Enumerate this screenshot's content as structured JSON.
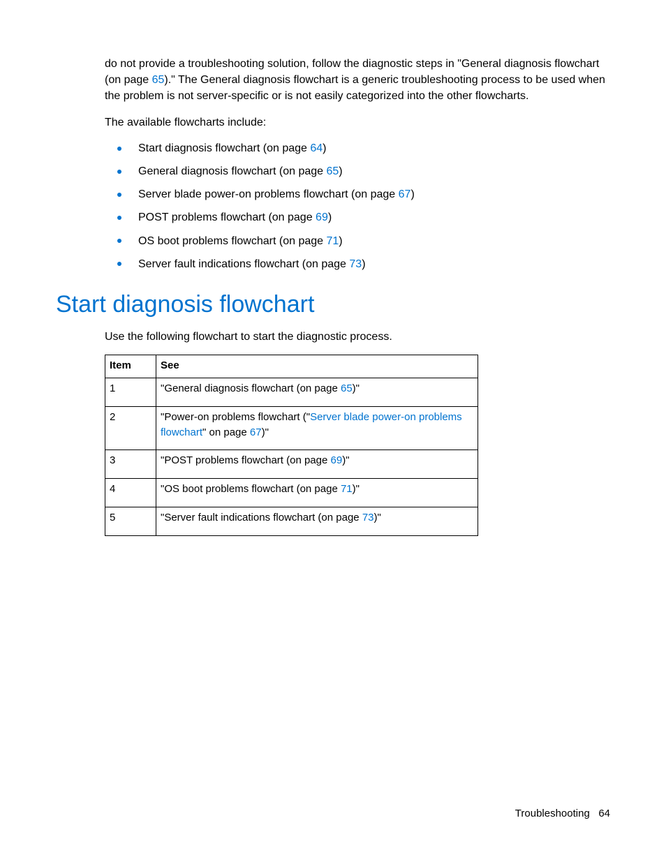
{
  "intro": {
    "para1_a": "do not provide a troubleshooting solution, follow the diagnostic steps in \"General diagnosis flowchart (on page ",
    "para1_link": "65",
    "para1_b": ").\" The General diagnosis flowchart is a generic troubleshooting process to be used when the problem is not server-specific or is not easily categorized into the other flowcharts.",
    "para2": "The available flowcharts include:"
  },
  "bullets": [
    {
      "pre": "Start diagnosis flowchart (on page ",
      "link": "64",
      "post": ")"
    },
    {
      "pre": "General diagnosis flowchart (on page ",
      "link": "65",
      "post": ")"
    },
    {
      "pre": "Server blade power-on problems flowchart (on page ",
      "link": "67",
      "post": ")"
    },
    {
      "pre": "POST problems flowchart (on page ",
      "link": "69",
      "post": ")"
    },
    {
      "pre": "OS boot problems flowchart (on page ",
      "link": "71",
      "post": ")"
    },
    {
      "pre": "Server fault indications flowchart (on page ",
      "link": "73",
      "post": ")"
    }
  ],
  "heading": "Start diagnosis flowchart",
  "subtext": "Use the following flowchart to start the diagnostic process.",
  "table": {
    "headers": {
      "col1": "Item",
      "col2": "See"
    },
    "rows": [
      {
        "item": "1",
        "segments": [
          {
            "t": "text",
            "v": "\"General diagnosis flowchart (on page "
          },
          {
            "t": "link",
            "v": "65"
          },
          {
            "t": "text",
            "v": ")\""
          }
        ]
      },
      {
        "item": "2",
        "segments": [
          {
            "t": "text",
            "v": "\"Power-on problems flowchart (\""
          },
          {
            "t": "link",
            "v": "Server blade power-on problems flowchart"
          },
          {
            "t": "text",
            "v": "\" on page "
          },
          {
            "t": "link",
            "v": "67"
          },
          {
            "t": "text",
            "v": ")\""
          }
        ]
      },
      {
        "item": "3",
        "segments": [
          {
            "t": "text",
            "v": "\"POST problems flowchart (on page "
          },
          {
            "t": "link",
            "v": "69"
          },
          {
            "t": "text",
            "v": ")\""
          }
        ]
      },
      {
        "item": "4",
        "segments": [
          {
            "t": "text",
            "v": "\"OS boot problems flowchart (on page "
          },
          {
            "t": "link",
            "v": "71"
          },
          {
            "t": "text",
            "v": ")\""
          }
        ]
      },
      {
        "item": "5",
        "segments": [
          {
            "t": "text",
            "v": "\"Server fault indications flowchart (on page "
          },
          {
            "t": "link",
            "v": "73"
          },
          {
            "t": "text",
            "v": ")\""
          }
        ]
      }
    ]
  },
  "footer": {
    "section": "Troubleshooting",
    "page": "64"
  }
}
